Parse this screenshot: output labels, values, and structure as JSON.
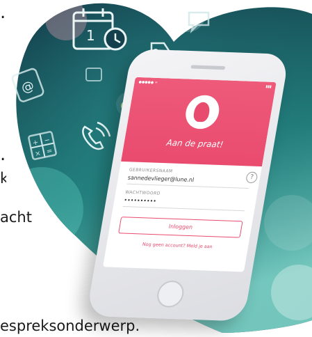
{
  "side_text": {
    "dot1": ".",
    "dot2": ".",
    "k": "k",
    "acht": "acht",
    "bottom": "espreksonderwerp."
  },
  "app": {
    "brand": "Aan de praat!",
    "username_label": "GEBRUIKERSNAAM",
    "username_value": "sannedevlieger@lune.nl",
    "password_label": "WACHTWOORD",
    "password_value": "••••••••••",
    "help_symbol": "?",
    "login_label": "Inloggen",
    "register_text": "Nog geen account? Meld je aan",
    "status_left": "●●●●● ≈",
    "status_right": "▮▮▮"
  },
  "icons": [
    "calendar-clock-icon",
    "price-tag-icon",
    "chat-bubble-icon",
    "envelope-icon",
    "phone-icon",
    "calculator-icon",
    "at-sign-icon",
    "card-icon"
  ],
  "colors": {
    "accent": "#e94b6e",
    "bg_teal": "#2fb3a6",
    "bg_dark": "#0f2e3a"
  }
}
